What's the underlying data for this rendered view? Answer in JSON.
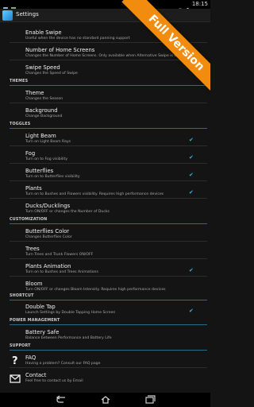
{
  "status_bar": {
    "time": "18:15"
  },
  "action_bar": {
    "title": "Settings"
  },
  "banner": {
    "text": "Full Version"
  },
  "items": {
    "enable_swipe": {
      "title": "Enable Swipe",
      "subtitle": "Useful when the device has no standard panning support"
    },
    "number_home": {
      "title": "Number of Home Screens",
      "subtitle": "Changes the Number of Home Screens. Only available when Alternative Swipe is On"
    },
    "swipe_speed": {
      "title": "Swipe Speed",
      "subtitle": "Changes the Speed of Swipe"
    },
    "theme": {
      "title": "Theme",
      "subtitle": "Changes the Season"
    },
    "background": {
      "title": "Background",
      "subtitle": "Change Background"
    },
    "light_beam": {
      "title": "Light Beam",
      "subtitle": "Turn on Light Beam Rays",
      "checked": true
    },
    "fog": {
      "title": "Fog",
      "subtitle": "Turn on to Fog visibility",
      "checked": true
    },
    "butterflies": {
      "title": "Butterflies",
      "subtitle": "Turn on to Butterflies visibility",
      "checked": true
    },
    "plants": {
      "title": "Plants",
      "subtitle": "Turn on to Bushes and Flowers visibility. Requires high performance devices",
      "checked": true
    },
    "ducks": {
      "title": "Ducks/Ducklings",
      "subtitle": "Turn ON/OFF or changes the Number of Ducks"
    },
    "butterflies_color": {
      "title": "Butterflies Color",
      "subtitle": "Changes Butterflies Color"
    },
    "trees": {
      "title": "Trees",
      "subtitle": "Turn Trees and Trunk Flowers ON/OFF"
    },
    "plants_anim": {
      "title": "Plants Animation",
      "subtitle": "Turn on to Bushes and Trees Animations",
      "checked": true
    },
    "bloom": {
      "title": "Bloom",
      "subtitle": "Turn ON/OFF or changes Bloom Intensity. Requires high performance devices"
    },
    "double_tap": {
      "title": "Double Tap",
      "subtitle": "Launch Settings by Double Tapping Home Screen",
      "checked": true
    },
    "battery": {
      "title": "Battery Safe",
      "subtitle": "Balance between Performance and Battery Life"
    },
    "faq": {
      "title": "FAQ",
      "subtitle": "Having a problem? Consult our FAQ page"
    },
    "contact": {
      "title": "Contact",
      "subtitle": "Feel free to contact us by Email"
    }
  },
  "sections": {
    "themes": "THEMES",
    "toggles": "TOGGLES",
    "customization": "CUSTOMIZATION",
    "shortcut": "SHORTCUT",
    "power": "POWER MANAGEMENT",
    "support": "SUPPORT"
  },
  "colors": {
    "accent": "#33b5e5",
    "banner": "#f28c0f",
    "background": "#141414"
  }
}
